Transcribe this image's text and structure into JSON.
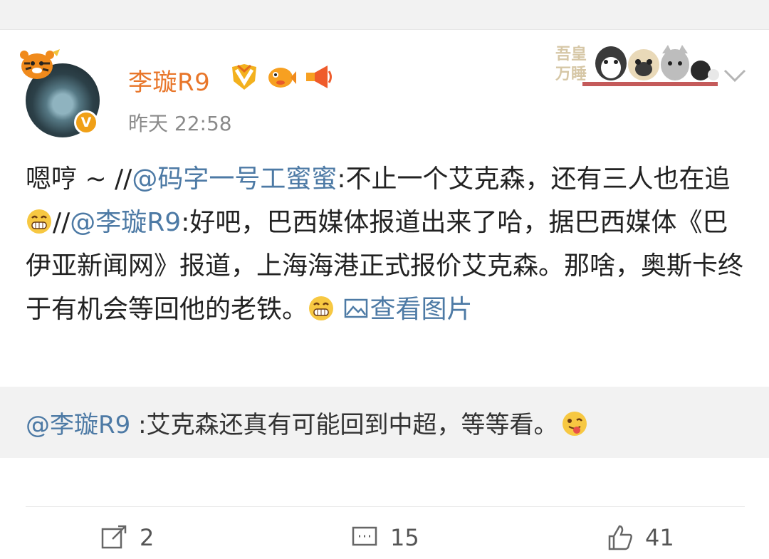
{
  "post": {
    "author": "李璇R9",
    "time": "昨天 22:58",
    "text": {
      "p1": "嗯哼 ~ //",
      "mention1": "@码字一号工蜜蜜",
      "p2": ":不止一个艾克森，还有三人也在追",
      "p3": "//",
      "mention2": "@李璇R9",
      "p4": ":好吧，巴西媒体报道出来了哈，据巴西媒体《巴伊亚新闻网》报道，上海海港正式报价艾克森。那啥，奥斯卡终于有机会等回他的老铁。",
      "link": "查看图片"
    },
    "banner_icon": "cartoon-pets-banner-icon",
    "badges": [
      "vip-badge-icon",
      "fish-badge-icon",
      "megaphone-badge-icon"
    ]
  },
  "retweet": {
    "mention": "@李璇R9",
    "text": " :艾克森还真有可能回到中超，等等看。"
  },
  "actions": {
    "repost": "2",
    "comment": "15",
    "like": "41"
  },
  "colors": {
    "name": "#e8762a",
    "link": "#4d7aa5",
    "text": "#222222",
    "muted": "#8a8a8a"
  }
}
